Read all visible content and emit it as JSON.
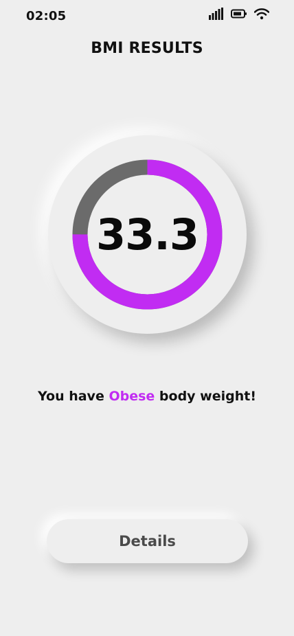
{
  "status_bar": {
    "time": "02:05",
    "icons": [
      "signal-icon",
      "battery-icon",
      "wifi-icon"
    ]
  },
  "header": {
    "title": "BMI RESULTS"
  },
  "gauge": {
    "value": "33.3",
    "fill_fraction": 0.75,
    "fill_color": "#c12cf2",
    "track_color": "#6b6b6b"
  },
  "result": {
    "prefix": "You have ",
    "category": "Obese",
    "suffix": " body weight!",
    "category_color": "#c12cf2"
  },
  "actions": {
    "details_label": "Details"
  }
}
